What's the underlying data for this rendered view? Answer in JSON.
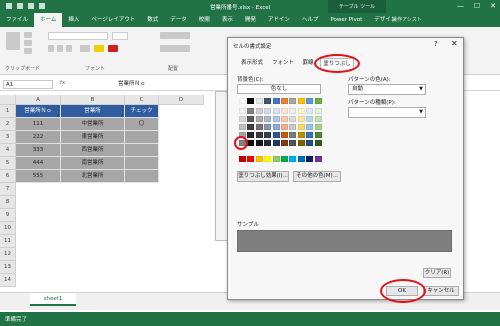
{
  "window": {
    "title": "営業所番号.xlsx - Excel",
    "contextual_tab": "テーブル ツール",
    "controls": [
      "—",
      "☐",
      "✕"
    ]
  },
  "ribbon": {
    "tabs": [
      "ファイル",
      "ホーム",
      "挿入",
      "ページレイアウト",
      "数式",
      "データ",
      "校閲",
      "表示",
      "開発",
      "アドイン",
      "ヘルプ",
      "Power Pivot",
      "デザイン"
    ],
    "active_tab": "ホーム",
    "search_placeholder": "操作アシスト",
    "groups": [
      "クリップボード",
      "フォント",
      "配置"
    ]
  },
  "formula_bar": {
    "cell_ref": "A1",
    "fx": "fx",
    "value": "営業所Ｎｏ"
  },
  "sheet": {
    "columns": [
      "A",
      "B",
      "C",
      "D"
    ],
    "rows": [
      "1",
      "2",
      "3",
      "4",
      "5",
      "6",
      "7",
      "8",
      "9",
      "10",
      "11",
      "12",
      "13",
      "14"
    ],
    "headers": [
      "営業所Ｎｏ",
      "営業所",
      "チェック"
    ],
    "data": [
      [
        "111",
        "中営業所",
        "〇"
      ],
      [
        "222",
        "東営業所",
        ""
      ],
      [
        "333",
        "西営業所",
        ""
      ],
      [
        "444",
        "南営業所",
        ""
      ],
      [
        "555",
        "北営業所",
        ""
      ]
    ],
    "tab_name": "sheet1",
    "status": "準備完了"
  },
  "dialog": {
    "title": "セルの書式設定",
    "help": "?",
    "close": "✕",
    "tabs": [
      "表示形式",
      "フォント",
      "罫線",
      "塗りつぶし"
    ],
    "active_tab": "塗りつぶし",
    "bg_color_label": "背景色(C):",
    "no_color_button": "色なし",
    "fill_effects_button": "塗りつぶし効果(I)...",
    "more_colors_button": "その他の色(M)...",
    "pattern_color_label": "パターンの色(A):",
    "pattern_color_value": "自動",
    "pattern_style_label": "パターンの種類(P):",
    "sample_label": "サンプル",
    "clear_button": "クリア(R)",
    "ok_button": "OK",
    "cancel_button": "キャンセル",
    "selected_fill": "#7f7f7f",
    "accent_ring": "#e0121a"
  }
}
